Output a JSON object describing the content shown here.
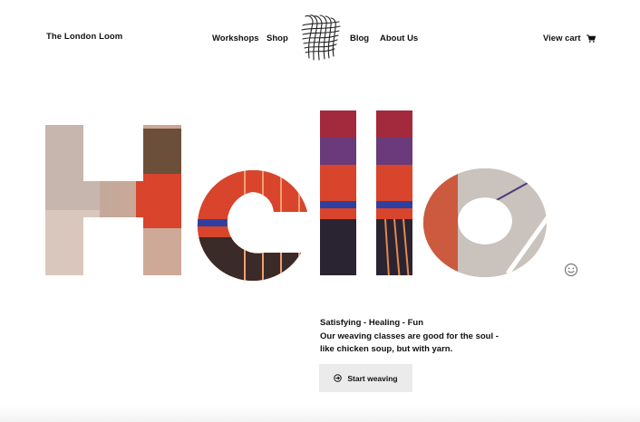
{
  "header": {
    "brand": "The London Loom",
    "nav": {
      "workshops": "Workshops",
      "shop": "Shop",
      "blog": "Blog",
      "about": "About Us"
    },
    "cart_label": "View cart"
  },
  "hero": {
    "word": "Hello"
  },
  "intro": {
    "heading": "Satisfying - Healing - Fun",
    "line1": "Our weaving classes are good for the soul -",
    "line2": "like chicken soup, but with yarn."
  },
  "cta": {
    "label": "Start weaving"
  },
  "icons": {
    "logo": "woven-square-logo",
    "cart": "cart-icon",
    "cta": "arrow-circle-icon",
    "floating": "smiley-face-icon"
  },
  "colors": {
    "text": "#111111",
    "button_bg": "#ebebeb",
    "yarn_red": "#d8442c",
    "yarn_blue": "#2f3fa0",
    "loom_wood": "#8a6a4a"
  }
}
